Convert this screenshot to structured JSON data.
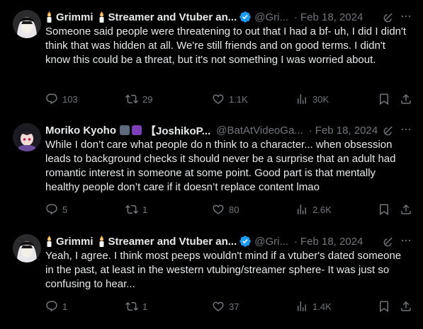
{
  "tweets": [
    {
      "name": "Grimmi",
      "name2": "Streamer and Vtuber an...",
      "handle": "@Gri...",
      "date": "Feb 18, 2024",
      "text": "Someone said people were threatening to out that I had a bf- uh, I did I didn't think that was hidden at all. We're still friends and on good terms. I didn't know this could be a threat, but it's not something I was worried about.",
      "replies": "103",
      "reposts": "29",
      "likes": "1.1K",
      "views": "30K"
    },
    {
      "name": "Moriko Kyoho",
      "name2": "【JoshikoP...",
      "handle": "@BatAtVideoGa...",
      "date": "Feb 18, 2024",
      "text": "While I don’t care what people do n think to a character... when obsession leads to background checks it should never be a surprise that an adult had romantic interest in someone at some point. Good part is that mentally healthy people don’t care if it doesn’t replace content lmao",
      "replies": "5",
      "reposts": "1",
      "likes": "80",
      "views": "2.6K"
    },
    {
      "name": "Grimmi",
      "name2": "Streamer and Vtuber an...",
      "handle": "@Gri...",
      "date": "Feb 18, 2024",
      "text": "Yeah, I agree. I think most peeps wouldn't mind if a vtuber's dated someone in the past, at least in the western vtubing/streamer sphere- It was just so confusing to hear...",
      "replies": "1",
      "reposts": "1",
      "likes": "37",
      "views": "1.4K"
    }
  ],
  "colors": {
    "background": "#000000",
    "text": "#e7e9ea",
    "muted": "#71767b",
    "verified": "#1d9bf0"
  },
  "icons": [
    "candle-icon",
    "verified-badge-icon",
    "grok-icon",
    "more-icon",
    "reply-icon",
    "repost-icon",
    "like-icon",
    "views-icon",
    "bookmark-icon",
    "share-icon"
  ]
}
